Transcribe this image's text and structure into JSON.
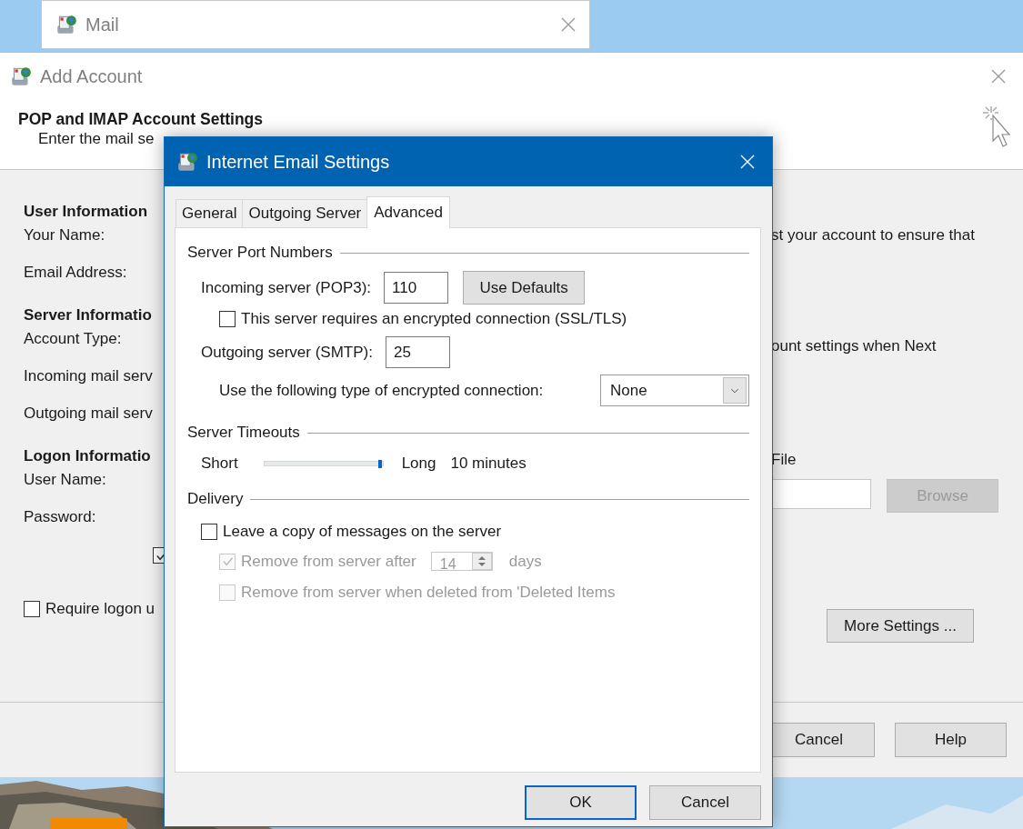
{
  "mail_window": {
    "title": "Mail"
  },
  "add_account": {
    "title": "Add Account",
    "heading": "POP and IMAP Account Settings",
    "subheading": "Enter the mail se",
    "left_rows": [
      {
        "kind": "heading",
        "text": "User Information"
      },
      {
        "kind": "label",
        "text": "Your Name:"
      },
      {
        "kind": "label",
        "text": "Email Address:"
      },
      {
        "kind": "heading",
        "text": "Server Informatio"
      },
      {
        "kind": "label",
        "text": "Account Type:"
      },
      {
        "kind": "label",
        "text": "Incoming mail serv"
      },
      {
        "kind": "label",
        "text": "Outgoing mail serv"
      },
      {
        "kind": "heading",
        "text": "Logon Informatio"
      },
      {
        "kind": "label",
        "text": "User Name:"
      },
      {
        "kind": "label",
        "text": "Password:"
      }
    ],
    "remember_checkbox": {
      "checked": true
    },
    "require_logon": {
      "label": "Require logon u",
      "checked": false
    },
    "right_texts": [
      "st your account to ensure that",
      "ount settings when Next"
    ],
    "data_file": {
      "label": "File",
      "browse": "Browse",
      "browse_disabled": true
    },
    "more_settings": "More Settings ...",
    "footer_buttons": [
      "Cancel",
      "Help"
    ]
  },
  "dialog": {
    "title": "Internet Email Settings",
    "tabs": [
      {
        "label": "General",
        "selected": false
      },
      {
        "label": "Outgoing Server",
        "selected": false
      },
      {
        "label": "Advanced",
        "selected": true
      }
    ],
    "server_ports": {
      "title": "Server Port Numbers",
      "incoming_label": "Incoming server (POP3):",
      "incoming_value": "110",
      "use_defaults": "Use Defaults",
      "ssl": {
        "label": "This server requires an encrypted connection (SSL/TLS)",
        "checked": false
      },
      "outgoing_label": "Outgoing server (SMTP):",
      "outgoing_value": "25",
      "encryption_label": "Use the following type of encrypted connection:",
      "encryption_value": "None"
    },
    "timeouts": {
      "title": "Server Timeouts",
      "min_label": "Short",
      "max_label": "Long",
      "level": 1.0,
      "reading": "10 minutes"
    },
    "delivery": {
      "title": "Delivery",
      "leave_copy": {
        "label": "Leave a copy of messages on the server",
        "checked": false
      },
      "remove_after": {
        "label": "Remove from server after",
        "checked": true,
        "disabled": true,
        "value": "14",
        "unit": "days"
      },
      "remove_deleted": {
        "label": "Remove from server when deleted from 'Deleted Items",
        "checked": false,
        "disabled": true
      }
    },
    "buttons": [
      {
        "label": "OK",
        "default": true
      },
      {
        "label": "Cancel",
        "default": false
      }
    ]
  }
}
